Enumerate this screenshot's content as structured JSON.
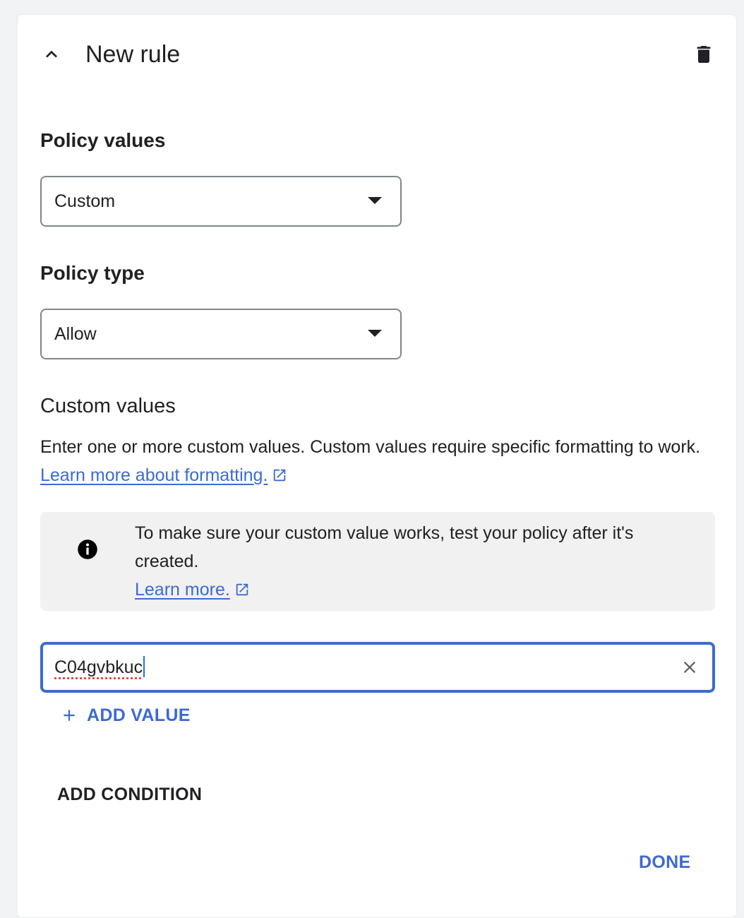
{
  "header": {
    "title": "New rule",
    "collapse_icon": "chevron-up-icon",
    "delete_icon": "trash-icon"
  },
  "policy_values": {
    "heading": "Policy values",
    "selected": "Custom"
  },
  "policy_type": {
    "heading": "Policy type",
    "selected": "Allow"
  },
  "custom_values": {
    "heading": "Custom values",
    "description": "Enter one or more custom values. Custom values require specific formatting to work.",
    "link_label": "Learn more about formatting.",
    "info": {
      "icon": "info-icon",
      "text": "To make sure your custom value works, test your policy after it's created.",
      "link_label": "Learn more."
    },
    "input_value": "C04gvbkuc",
    "clear_icon": "close-icon"
  },
  "actions": {
    "add_value": "ADD VALUE",
    "add_condition": "ADD CONDITION",
    "done": "DONE"
  },
  "colors": {
    "accent": "#3c6ad4",
    "text": "#202124",
    "info_bg": "#f1f1f1",
    "border": "#80868b"
  }
}
